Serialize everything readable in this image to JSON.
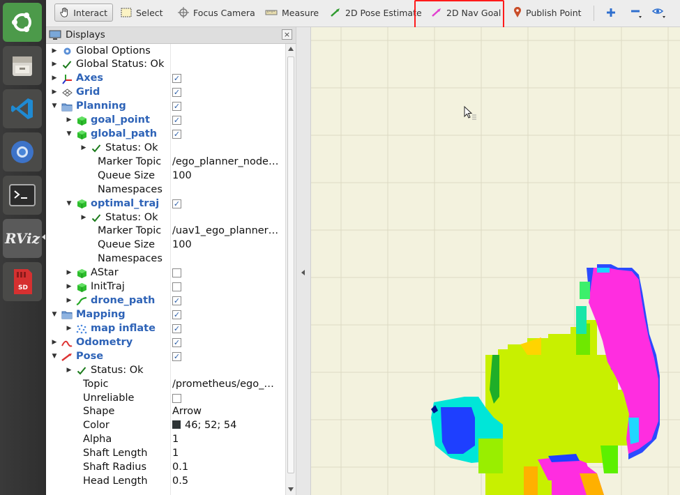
{
  "launcher": {
    "items": [
      "ubuntu-logo-icon",
      "files-icon",
      "vscode-icon",
      "chromium-icon",
      "terminal-icon",
      "rviz-icon",
      "sd-card-icon"
    ],
    "rviz_label": "RViz",
    "sd_label": "SD"
  },
  "toolbar": {
    "interact": "Interact",
    "select": "Select",
    "focus_camera": "Focus Camera",
    "measure": "Measure",
    "pose_estimate": "2D Pose Estimate",
    "nav_goal": "2D Nav Goal",
    "publish_point": "Publish Point"
  },
  "colors": {
    "highlight": "#ff1a1a",
    "tree_blue": "#2e63b7",
    "check": "#2c5fa8",
    "grid_bg": "#f3f2de",
    "pose_color_swatch": "#2e3436"
  },
  "displays": {
    "title": "Displays",
    "close": "×",
    "rows": [
      {
        "label": "Global Options",
        "value": "",
        "checkbox": null
      },
      {
        "label": "Global Status: Ok",
        "value": "",
        "checkbox": null
      },
      {
        "label": "Axes",
        "value": "",
        "checkbox": true
      },
      {
        "label": "Grid",
        "value": "",
        "checkbox": true
      },
      {
        "label": "Planning",
        "value": "",
        "checkbox": true
      },
      {
        "label": "goal_point",
        "value": "",
        "checkbox": true
      },
      {
        "label": "global_path",
        "value": "",
        "checkbox": true
      },
      {
        "label": "Status: Ok",
        "value": "",
        "checkbox": null
      },
      {
        "label": "Marker Topic",
        "value": "/ego_planner_node…",
        "checkbox": null
      },
      {
        "label": "Queue Size",
        "value": "100",
        "checkbox": null
      },
      {
        "label": "Namespaces",
        "value": "",
        "checkbox": null
      },
      {
        "label": "optimal_traj",
        "value": "",
        "checkbox": true
      },
      {
        "label": "Status: Ok",
        "value": "",
        "checkbox": null
      },
      {
        "label": "Marker Topic",
        "value": "/uav1_ego_planner…",
        "checkbox": null
      },
      {
        "label": "Queue Size",
        "value": "100",
        "checkbox": null
      },
      {
        "label": "Namespaces",
        "value": "",
        "checkbox": null
      },
      {
        "label": "AStar",
        "value": "",
        "checkbox": false
      },
      {
        "label": "InitTraj",
        "value": "",
        "checkbox": false
      },
      {
        "label": "drone_path",
        "value": "",
        "checkbox": true
      },
      {
        "label": "Mapping",
        "value": "",
        "checkbox": true
      },
      {
        "label": "map inflate",
        "value": "",
        "checkbox": true
      },
      {
        "label": "Odometry",
        "value": "",
        "checkbox": true
      },
      {
        "label": "Pose",
        "value": "",
        "checkbox": true
      },
      {
        "label": "Status: Ok",
        "value": "",
        "checkbox": null
      },
      {
        "label": "Topic",
        "value": "/prometheus/ego_…",
        "checkbox": null
      },
      {
        "label": "Unreliable",
        "value": "",
        "checkbox": false
      },
      {
        "label": "Shape",
        "value": "Arrow",
        "checkbox": null
      },
      {
        "label": "Color",
        "value": "46; 52; 54",
        "checkbox": null
      },
      {
        "label": "Alpha",
        "value": "1",
        "checkbox": null
      },
      {
        "label": "Shaft Length",
        "value": "1",
        "checkbox": null
      },
      {
        "label": "Shaft Radius",
        "value": "0.1",
        "checkbox": null
      },
      {
        "label": "Head Length",
        "value": "0.5",
        "checkbox": null
      }
    ]
  }
}
